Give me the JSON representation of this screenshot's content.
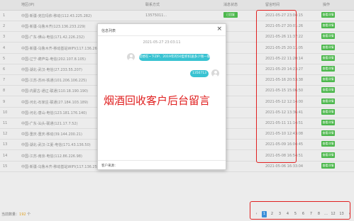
{
  "table": {
    "headers": {
      "region": "地区(IP)",
      "contact": "联系方式",
      "status": "消息状态",
      "time": "留言时间",
      "actions": "操作"
    },
    "rows": [
      {
        "index": "1",
        "region": "中国-新疆-克拉玛依-移动(112.43.225.282)",
        "contact": "13575011...",
        "status": "已回复",
        "time": "2021-05-27 23:04:15",
        "action": "查看详情"
      },
      {
        "index": "2",
        "region": "中国-新疆-乌鲁木齐(123.136.233.229)",
        "contact": "",
        "status": "",
        "time": "2021-05-27 20:01:26",
        "action": "查看详情"
      },
      {
        "index": "3",
        "region": "中国-广东-佛山-电信(171.42.226.232)",
        "contact": "",
        "status": "",
        "time": "2021-05-26 11:37:22",
        "action": "查看详情"
      },
      {
        "index": "4",
        "region": "中国-新疆-乌鲁木齐-移动基站WIFI(117.136.26.174)",
        "contact": "",
        "status": "",
        "time": "2021-05-25 20:11:05",
        "action": "查看详情"
      },
      {
        "index": "5",
        "region": "中国-辽宁-葫芦岛-电信(202.107.8.105)",
        "contact": "",
        "status": "",
        "time": "2021-05-22 11:20:14",
        "action": "查看详情"
      },
      {
        "index": "6",
        "region": "中国-湖北-武汉-电信(27.233.55.207)",
        "contact": "",
        "status": "",
        "time": "2021-05-20 14:23:27",
        "action": "查看详情"
      },
      {
        "index": "7",
        "region": "中国-江苏-苏州-铁通(101.206.106.225)",
        "contact": "",
        "status": "",
        "time": "2021-05-16 20:53:38",
        "action": "查看详情"
      },
      {
        "index": "8",
        "region": "中国-内蒙古-通辽-联通(110.18.190.190)",
        "contact": "",
        "status": "",
        "time": "2021-05-15 15:06:50",
        "action": "查看详情"
      },
      {
        "index": "9",
        "region": "中国-河北-石家庄-联通(27.184.103.189)",
        "contact": "",
        "status": "",
        "time": "2021-05-12 12:14:00",
        "action": "查看详情"
      },
      {
        "index": "10",
        "region": "中国-河北-唐山-电信(123.181.176.140)",
        "contact": "",
        "status": "",
        "time": "2021-05-12 13:36:41",
        "action": "查看详情"
      },
      {
        "index": "11",
        "region": "中国-广东-汕头-联通(121.17.7.52)",
        "contact": "",
        "status": "",
        "time": "2021-05-11 11:14:51",
        "action": "查看详情"
      },
      {
        "index": "12",
        "region": "中国-重庆-重庆-移动(39.144.200.21)",
        "contact": "",
        "status": "",
        "time": "2021-05-10 12:43:08",
        "action": "查看详情"
      },
      {
        "index": "13",
        "region": "中国-湖北-武汉-江夏-电信(171.43.136.50)",
        "contact": "",
        "status": "",
        "time": "2021-05-09 16:04:45",
        "action": "查看详情"
      },
      {
        "index": "14",
        "region": "中国-江苏-南京-电信(112.86.226.98)",
        "contact": "",
        "status": "",
        "time": "2021-05-08 16:54:51",
        "action": "查看详情"
      },
      {
        "index": "15",
        "region": "中国-新疆-乌鲁木齐-移动基站WIFI(117.136.25.175)",
        "contact": "",
        "status": "",
        "time": "2021-05-06 16:33:04",
        "action": "查看详情"
      }
    ]
  },
  "dialog": {
    "title": "信息列表",
    "close": "×",
    "timestamp": "2021-05-27 23:03:11",
    "message_in": "您想在~下ZIP、2019年的50型折扣送多少钱一瓶？",
    "message_out": "1350713",
    "reply_label": "客户来源："
  },
  "caption": "烟酒回收客户后台留言",
  "footer": {
    "total_label": "当前数量：",
    "total_value": "192",
    "total_unit": "个"
  },
  "pagination": {
    "items": [
      "‹",
      "1",
      "2",
      "3",
      "4",
      "5",
      "6",
      "7",
      "8",
      "…",
      "12",
      "13",
      "›"
    ],
    "active": "1"
  }
}
